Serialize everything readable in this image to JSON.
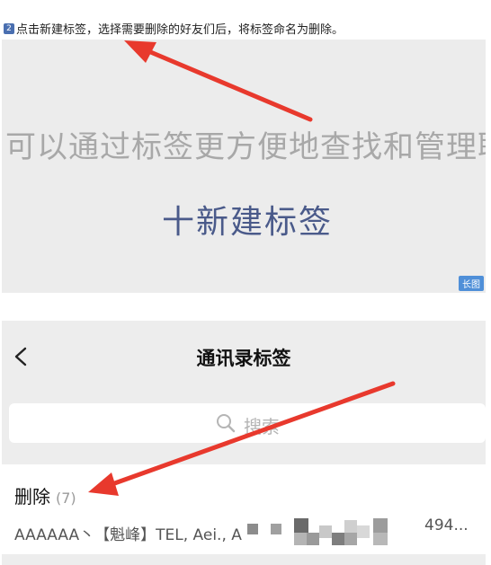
{
  "step": {
    "number": "2",
    "text": "点击新建标签，选择需要删除的好友们后，将标签命名为删除。"
  },
  "top_panel": {
    "tip_text": "可以通过标签更方便地查找和管理联系",
    "new_tag_label": "十新建标签",
    "long_image_badge": "长图"
  },
  "bottom_panel": {
    "nav_title": "通讯录标签",
    "search_placeholder": "搜索",
    "tag": {
      "name": "删除",
      "count": "(7)",
      "members": "AAAAAA丶【魁峰】TEL, Aei., A",
      "members_tail": "494..."
    }
  },
  "colors": {
    "arrow": "#e8392d",
    "new_tag_text": "#4a5a8a",
    "panel_bg": "#ececec",
    "badge_bg": "#4f8fd8"
  },
  "icons": [
    "back-chevron-icon",
    "search-icon"
  ]
}
